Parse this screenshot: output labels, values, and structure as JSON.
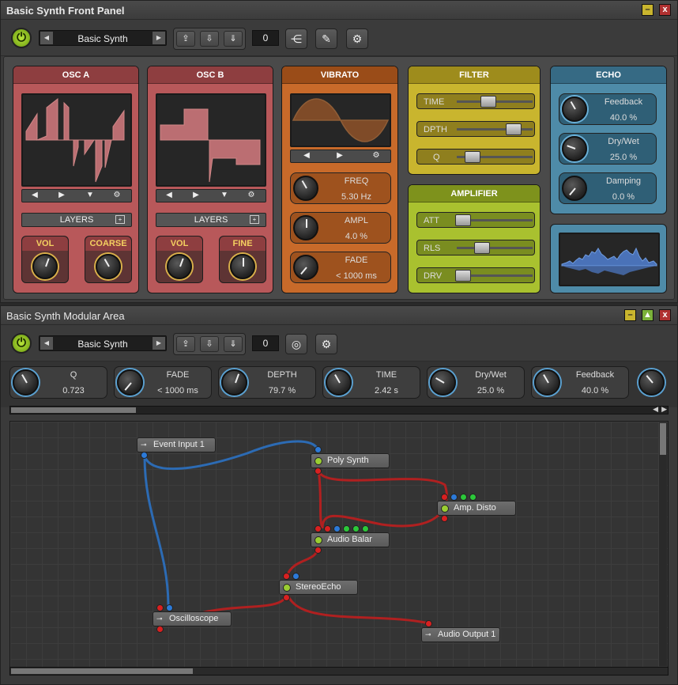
{
  "front_panel": {
    "title": "Basic Synth Front Panel",
    "preset": "Basic Synth",
    "count": "0",
    "osc_a": {
      "title": "OSC A",
      "layers": "LAYERS",
      "vol": "VOL",
      "coarse": "COARSE"
    },
    "osc_b": {
      "title": "OSC B",
      "layers": "LAYERS",
      "vol": "VOL",
      "fine": "FINE"
    },
    "vibrato": {
      "title": "VIBRATO",
      "freq_label": "FREQ",
      "freq_value": "5.30 Hz",
      "ampl_label": "AMPL",
      "ampl_value": "4.0 %",
      "fade_label": "FADE",
      "fade_value": "< 1000 ms"
    },
    "filter": {
      "title": "FILTER",
      "time": "TIME",
      "time_level": 0.45,
      "dpth": "DPTH",
      "dpth_level": 0.8,
      "q": "Q",
      "q_level": 0.2
    },
    "amplifier": {
      "title": "AMPLIFIER",
      "att": "ATT",
      "att_level": 0.05,
      "rls": "RLS",
      "rls_level": 0.3,
      "drv": "DRV",
      "drv_level": 0.05
    },
    "echo": {
      "title": "ECHO",
      "feedback_label": "Feedback",
      "feedback_value": "40.0 %",
      "drywet_label": "Dry/Wet",
      "drywet_value": "25.0 %",
      "damping_label": "Damping",
      "damping_value": "0.0 %"
    }
  },
  "modular": {
    "title": "Basic Synth Modular Area",
    "preset": "Basic Synth",
    "count": "0",
    "knobs": [
      {
        "label": "Q",
        "value": "0.723"
      },
      {
        "label": "FADE",
        "value": "< 1000 ms"
      },
      {
        "label": "DEPTH",
        "value": "79.7 %"
      },
      {
        "label": "TIME",
        "value": "2.42 s"
      },
      {
        "label": "Dry/Wet",
        "value": "25.0 %"
      },
      {
        "label": "Feedback",
        "value": "40.0 %"
      }
    ],
    "nodes": {
      "event_input": "Event Input 1",
      "poly_synth": "Poly Synth",
      "amp_disto": "Amp. Disto",
      "audio_balance": "Audio Balar",
      "stereo_echo": "StereoEcho",
      "oscilloscope": "Oscilloscope",
      "audio_output": "Audio Output 1"
    }
  },
  "colors": {
    "osc": "#b8585a",
    "vibrato": "#c86a2a",
    "filter": "#c9b52e",
    "amplifier": "#a9c12f",
    "echo": "#4e8ba8",
    "blue_wire": "#2c6bb4",
    "red_wire": "#b02020",
    "power": "#9acd32"
  }
}
